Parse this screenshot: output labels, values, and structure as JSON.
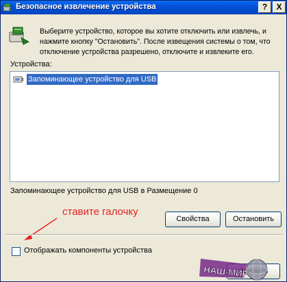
{
  "window": {
    "title": "Безопасное извлечение устройства",
    "help_label": "?",
    "close_label": "X"
  },
  "icons": {
    "title": "safely-remove-hardware-icon",
    "hero": "safely-remove-hardware-icon",
    "usb_device": "usb-storage-icon"
  },
  "instructions": "Выберите устройство, которое вы хотите отключить или извлечь, и нажмите кнопку \"Остановить\". После извещения системы о том, что отключение устройства разрешено, отключите и извлеките его.",
  "devices": {
    "label": "Устройства:",
    "items": [
      {
        "label": "Запоминающее устройство для USB",
        "selected": true
      }
    ]
  },
  "status_text": "Запоминающее устройство для USB в Размещение 0",
  "buttons": {
    "properties": "Свойства",
    "stop": "Остановить",
    "close": "Закрыть"
  },
  "checkbox": {
    "label": "Отображать компоненты устройства",
    "checked": false
  },
  "annotation": {
    "text": "ставите галочку",
    "color": "#e62020"
  },
  "watermark": {
    "text": "НАШ-МИР"
  },
  "colors": {
    "titlebar": "#0553d8",
    "selection": "#316ac5",
    "dialog_bg": "#ece9d8"
  }
}
